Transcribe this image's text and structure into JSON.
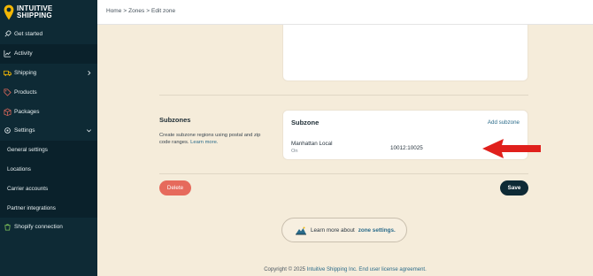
{
  "brand": {
    "name_line1": "INTUITIVE",
    "name_line2": "SHIPPING"
  },
  "breadcrumb": {
    "home": "Home",
    "zones": "Zones",
    "current": "Edit zone",
    "separator": ">"
  },
  "sidebar": {
    "items": [
      {
        "label": "Get started",
        "icon": "rocket-icon"
      },
      {
        "label": "Activity",
        "icon": "chart-icon"
      },
      {
        "label": "Shipping",
        "icon": "truck-icon",
        "has_children": true
      },
      {
        "label": "Products",
        "icon": "tag-icon"
      },
      {
        "label": "Packages",
        "icon": "package-icon"
      },
      {
        "label": "Settings",
        "icon": "gear-icon",
        "expanded": true
      },
      {
        "label": "General settings"
      },
      {
        "label": "Locations"
      },
      {
        "label": "Carrier accounts"
      },
      {
        "label": "Partner integrations"
      },
      {
        "label": "Shopify connection",
        "icon": "shopify-icon"
      }
    ]
  },
  "subzones_section": {
    "title": "Subzones",
    "description": "Create subzone regions using postal and zip code ranges.",
    "learn_more": "Learn more."
  },
  "subzone_card": {
    "title": "Subzone",
    "add_label": "Add subzone",
    "row": {
      "name": "Manhattan Local",
      "status": "On",
      "range": "10012:10025"
    }
  },
  "actions": {
    "delete_label": "Delete",
    "save_label": "Save"
  },
  "learn_pill": {
    "text": "Learn more about",
    "link": "zone settings."
  },
  "footer": {
    "text": "Copyright © 2025",
    "company": "Intuitive Shipping Inc.",
    "eula": "End user license agreement."
  },
  "colors": {
    "sidebar_bg": "#0e2a35",
    "accent_gold": "#f2b705",
    "delete_red": "#e66a5c",
    "arrow_red": "#e0201c",
    "link": "#2a6b8a"
  }
}
